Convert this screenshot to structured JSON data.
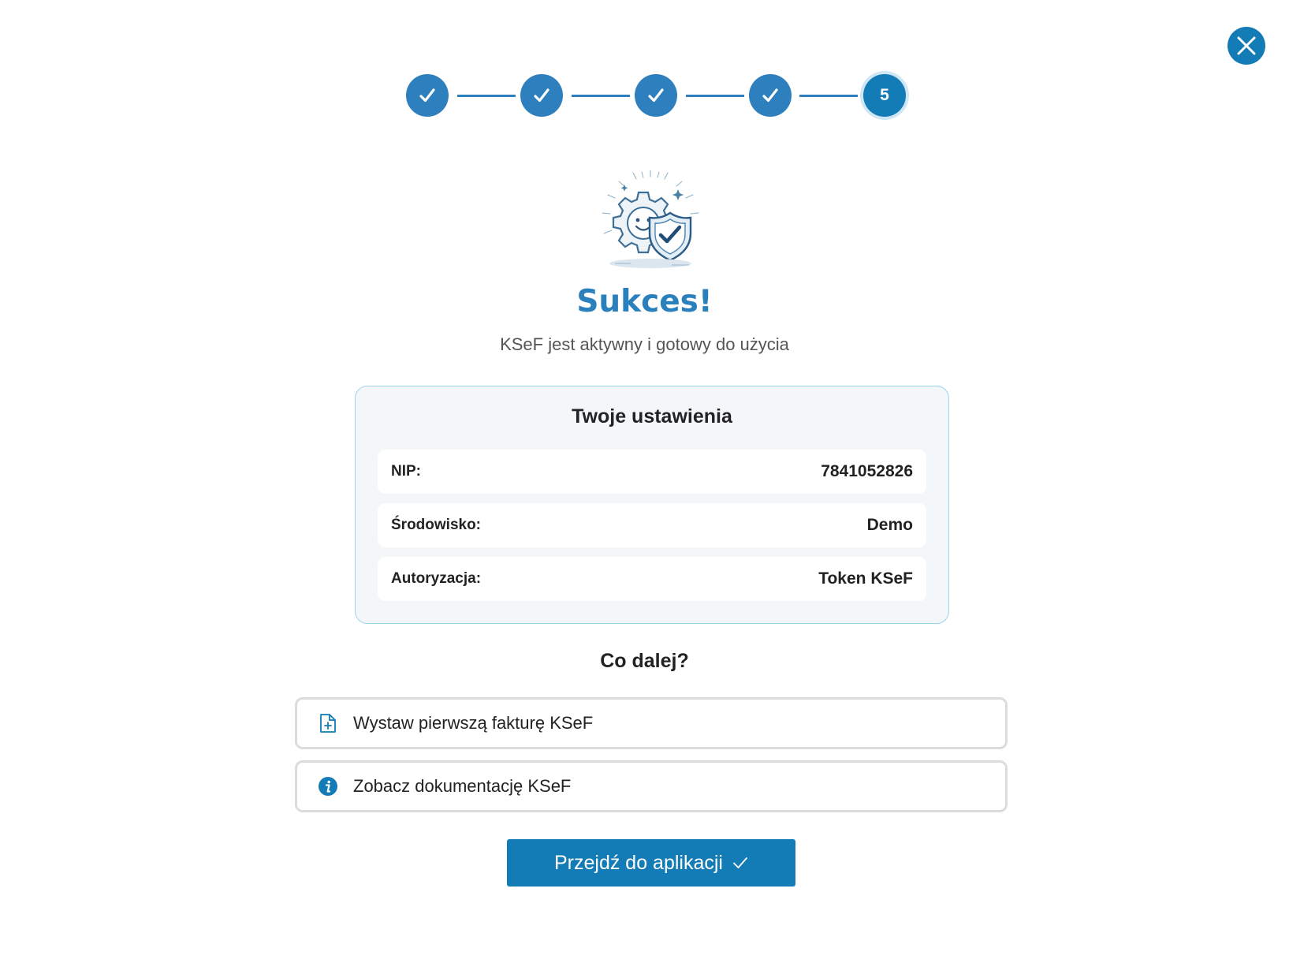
{
  "close": {
    "icon": "close-icon"
  },
  "stepper": {
    "current_step": 5,
    "total_steps": 5,
    "steps": [
      {
        "state": "done",
        "icon": "check-icon"
      },
      {
        "state": "done",
        "icon": "check-icon"
      },
      {
        "state": "done",
        "icon": "check-icon"
      },
      {
        "state": "done",
        "icon": "check-icon"
      },
      {
        "state": "current",
        "label": "5"
      }
    ]
  },
  "illustration": {
    "icon": "gear-shield-success-illustration"
  },
  "header": {
    "title": "Sukces!",
    "subtitle": "KSeF jest aktywny i gotowy do użycia"
  },
  "settings": {
    "title": "Twoje ustawienia",
    "rows": [
      {
        "label": "NIP:",
        "value": "7841052826"
      },
      {
        "label": "Środowisko:",
        "value": "Demo"
      },
      {
        "label": "Autoryzacja:",
        "value": "Token KSeF"
      }
    ]
  },
  "next": {
    "title": "Co dalej?",
    "items": [
      {
        "label": "Wystaw pierwszą fakturę KSeF",
        "icon": "file-plus-icon"
      },
      {
        "label": "Zobacz dokumentację KSeF",
        "icon": "info-icon"
      }
    ]
  },
  "cta": {
    "label": "Przejdź do aplikacji",
    "icon": "check-icon"
  },
  "colors": {
    "primary": "#137bb6",
    "step": "#2e7fbd",
    "title": "#2a80bd",
    "card_border": "#9cd3ee",
    "card_bg": "#f4f7fa"
  }
}
